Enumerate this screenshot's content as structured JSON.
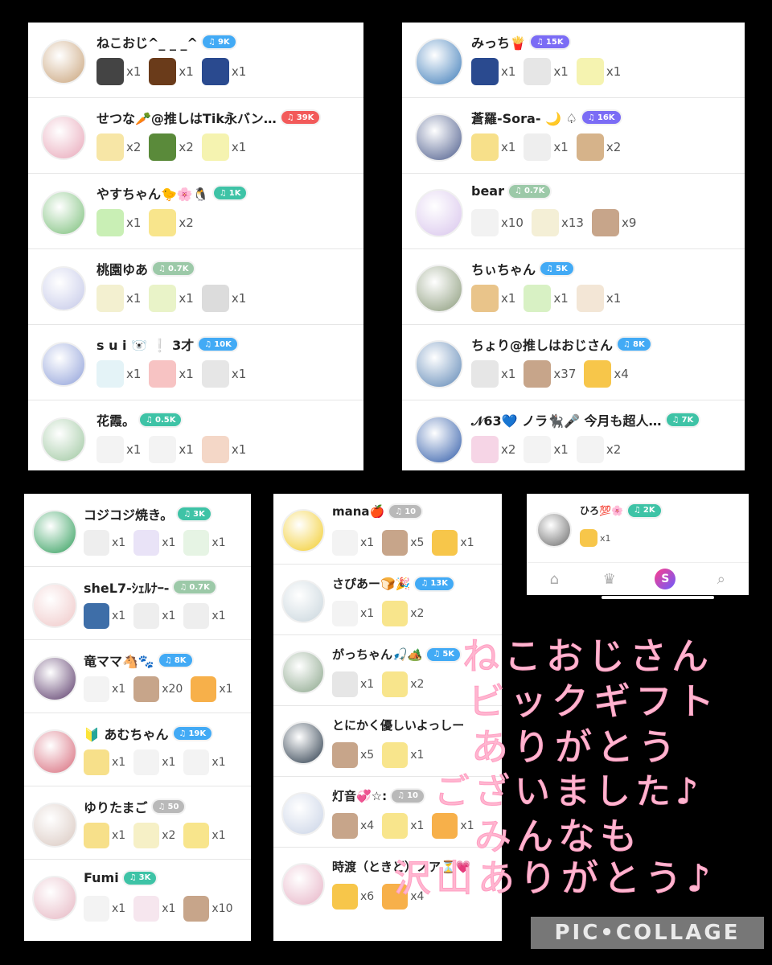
{
  "colors": {
    "badge_blue": "#42aaf5",
    "badge_red": "#f25a5a",
    "badge_green": "#3ec3a6",
    "badge_gray": "#b9b9b9",
    "badge_purple": "#7b6cf5",
    "badge_olive": "#9cc9a8",
    "badge_darkblue": "#5a8ff0"
  },
  "panels": [
    {
      "rows": [
        {
          "name": "ねこおじ^_ _ _^",
          "badge": "9K",
          "badge_color": "#42aaf5",
          "avatar_color": "#c9a37a",
          "gifts": [
            {
              "icon": "night-gift-icon",
              "color": "#444",
              "count": "x1"
            },
            {
              "icon": "fireworks-gift-icon",
              "color": "#6a3b1a",
              "count": "x1"
            },
            {
              "icon": "fever-penguin-gift-icon",
              "color": "#2a4a8f",
              "count": "x1"
            }
          ]
        },
        {
          "name": "せつな🥕@推しはTik永バン…",
          "badge": "39K",
          "badge_color": "#f25a5a",
          "avatar_color": "#e8a6b8",
          "gifts": [
            {
              "icon": "confetti-gift-icon",
              "color": "#f7e6a6",
              "count": "x2"
            },
            {
              "icon": "ghost-gift-icon",
              "color": "#5a8a3a",
              "count": "x2"
            },
            {
              "icon": "rap-gift-icon",
              "color": "#f5f3b0",
              "count": "x1"
            }
          ]
        },
        {
          "name": "やすちゃん🐤🌸🐧",
          "badge": "1K",
          "badge_color": "#3ec3a6",
          "avatar_color": "#7bbf7a",
          "gifts": [
            {
              "icon": "clover-gift-icon",
              "color": "#c9efb5",
              "count": "x1"
            },
            {
              "icon": "oshi-ari-gift-icon",
              "color": "#f8e58c",
              "count": "x2"
            }
          ]
        },
        {
          "name": "桃園ゆあ",
          "badge": "0.7K",
          "badge_color": "#9cc9a8",
          "avatar_color": "#c4c8e8",
          "gifts": [
            {
              "icon": "bouquet-gift-icon",
              "color": "#f3f0d0",
              "count": "x1"
            },
            {
              "icon": "hands-gift-icon",
              "color": "#e9f3c8",
              "count": "x1"
            },
            {
              "icon": "panda-text-gift-icon",
              "color": "#dcdcdc",
              "count": "x1"
            }
          ]
        },
        {
          "name": "s u i 🐻‍❄️ ❕ 3才",
          "badge": "10K",
          "badge_color": "#42aaf5",
          "avatar_color": "#8fa0d9",
          "gifts": [
            {
              "icon": "sparkle-gift-icon",
              "color": "#e4f3f7",
              "count": "x1"
            },
            {
              "icon": "kyaa-gift-icon",
              "color": "#f7c3c3",
              "count": "x1"
            },
            {
              "icon": "panda-cry-gift-icon",
              "color": "#e6e6e6",
              "count": "x1"
            }
          ]
        },
        {
          "name": "花霞。",
          "badge": "0.5K",
          "badge_color": "#3ec3a6",
          "avatar_color": "#9ec7a0",
          "gifts": [
            {
              "icon": "rabbit-gift-icon",
              "color": "#f3f3f3",
              "count": "x1"
            },
            {
              "icon": "cat-gift-icon",
              "color": "#f3f3f3",
              "count": "x1"
            },
            {
              "icon": "sign-gift-icon",
              "color": "#f4d7c7",
              "count": "x1"
            }
          ]
        }
      ]
    },
    {
      "rows": [
        {
          "name": "みっち🍟",
          "badge": "15K",
          "badge_color": "#7b6cf5",
          "avatar_color": "#3b7ab8",
          "gifts": [
            {
              "icon": "fever-penguin-gift-icon",
              "color": "#2a4a8f",
              "count": "x1"
            },
            {
              "icon": "koala-gift-icon",
              "color": "#e6e6e6",
              "count": "x1"
            },
            {
              "icon": "rap-gift-icon",
              "color": "#f5f3b0",
              "count": "x1"
            }
          ]
        },
        {
          "name": "蒼羅-Sora- 🌙 ♤",
          "badge": "16K",
          "badge_color": "#7b6cf5",
          "avatar_color": "#4a5a8a",
          "gifts": [
            {
              "icon": "sushi-gift-icon",
              "color": "#f7e08a",
              "count": "x1"
            },
            {
              "icon": "penguin-gift-icon",
              "color": "#eeeeee",
              "count": "x1"
            },
            {
              "icon": "potato-gift-icon",
              "color": "#d6b38a",
              "count": "x2"
            }
          ]
        },
        {
          "name": "bear",
          "badge": "0.7K",
          "badge_color": "#9cc9a8",
          "avatar_color": "#d8c4ec",
          "gifts": [
            {
              "icon": "bear-gift-icon",
              "color": "#f2f2f2",
              "count": "x10"
            },
            {
              "icon": "music-note-gift-icon",
              "color": "#f4efd6",
              "count": "x13"
            },
            {
              "icon": "hearts-gift-icon",
              "color": "#c7a58a",
              "count": "x9"
            }
          ]
        },
        {
          "name": "ちぃちゃん",
          "badge": "5K",
          "badge_color": "#42aaf5",
          "avatar_color": "#8a9a7a",
          "gifts": [
            {
              "icon": "bear-face-gift-icon",
              "color": "#e9c48a",
              "count": "x1"
            },
            {
              "icon": "sugoi-gift-icon",
              "color": "#d8f1c4",
              "count": "x1"
            },
            {
              "icon": "cat-food-gift-icon",
              "color": "#f3e6d6",
              "count": "x1"
            }
          ]
        },
        {
          "name": "ちょり@推しはおじさん",
          "badge": "8K",
          "badge_color": "#42aaf5",
          "avatar_color": "#5d86b5",
          "gifts": [
            {
              "icon": "koala-gift-icon",
              "color": "#e6e6e6",
              "count": "x1"
            },
            {
              "icon": "hearts-gift-icon",
              "color": "#c7a58a",
              "count": "x37"
            },
            {
              "icon": "clap-gift-icon",
              "color": "#f7c64a",
              "count": "x4"
            }
          ]
        },
        {
          "name": "𝒩63💙 ノラ🐈‍⬛🎤 今月も超人…",
          "badge": "7K",
          "badge_color": "#3ec3a6",
          "avatar_color": "#2e5aa8",
          "gifts": [
            {
              "icon": "thanks-gift-icon",
              "color": "#f6d5e6",
              "count": "x2"
            },
            {
              "icon": "tamarine-gift-icon",
              "color": "#f3f3f3",
              "count": "x1"
            },
            {
              "icon": "black-cat-gift-icon",
              "color": "#f3f3f3",
              "count": "x2"
            }
          ]
        }
      ]
    },
    {
      "rows": [
        {
          "name": "コジコジ焼き。",
          "badge": "3K",
          "badge_color": "#3ec3a6",
          "avatar_color": "#2f9d5a",
          "gifts": [
            {
              "icon": "penguin-gift-icon",
              "color": "#eeeeee",
              "count": "x1"
            },
            {
              "icon": "bed-gift-icon",
              "color": "#e9e3f7",
              "count": "x1"
            },
            {
              "icon": "morning-gift-icon",
              "color": "#e6f4e4",
              "count": "x1"
            }
          ]
        },
        {
          "name": "sheL7-ｼｪﾙﾅｰ-",
          "badge": "0.7K",
          "badge_color": "#9cc9a8",
          "avatar_color": "#efc7c7",
          "gifts": [
            {
              "icon": "polar-bear-gift-icon",
              "color": "#3e6ea8",
              "count": "x1"
            },
            {
              "icon": "onigiri-gift-icon",
              "color": "#eeeeee",
              "count": "x1"
            },
            {
              "icon": "hello-penguin-gift-icon",
              "color": "#eeeeee",
              "count": "x1"
            }
          ]
        },
        {
          "name": "竜ママ🐴🐾",
          "badge": "8K",
          "badge_color": "#42aaf5",
          "avatar_color": "#5a3a6a",
          "gifts": [
            {
              "icon": "tamarine-gift-icon",
              "color": "#f3f3f3",
              "count": "x1"
            },
            {
              "icon": "hearts-gift-icon",
              "color": "#c7a58a",
              "count": "x20"
            },
            {
              "icon": "smile-gift-icon",
              "color": "#f7b04a",
              "count": "x1"
            }
          ]
        },
        {
          "name": "🔰 あむちゃん",
          "badge": "19K",
          "badge_color": "#42aaf5",
          "avatar_color": "#d76a7a",
          "gifts": [
            {
              "icon": "sushi-gift-icon",
              "color": "#f7e08a",
              "count": "x1"
            },
            {
              "icon": "panda-love-gift-icon",
              "color": "#f3f3f3",
              "count": "x1"
            },
            {
              "icon": "rabbit-thanks-gift-icon",
              "color": "#f3f3f3",
              "count": "x1"
            }
          ]
        },
        {
          "name": "ゆりたまご",
          "badge": "50",
          "badge_color": "#b9b9b9",
          "avatar_color": "#d9c8c0",
          "gifts": [
            {
              "icon": "sushi-gift-icon",
              "color": "#f7e08a",
              "count": "x1"
            },
            {
              "icon": "yay-gift-icon",
              "color": "#f6f0c6",
              "count": "x2"
            },
            {
              "icon": "oshi-ari-gift-icon",
              "color": "#f8e58c",
              "count": "x1"
            }
          ]
        },
        {
          "name": "Fumi",
          "badge": "3K",
          "badge_color": "#3ec3a6",
          "avatar_color": "#e6b6c2",
          "gifts": [
            {
              "icon": "seal-gift-icon",
              "color": "#f3f3f3",
              "count": "x1"
            },
            {
              "icon": "penguin-pink-gift-icon",
              "color": "#f6e6ee",
              "count": "x1"
            },
            {
              "icon": "hearts-gift-icon",
              "color": "#c7a58a",
              "count": "x10"
            }
          ]
        }
      ]
    },
    {
      "rows": [
        {
          "name": "mana🍎",
          "badge": "10",
          "badge_color": "#b9b9b9",
          "avatar_color": "#f2cc2a",
          "gifts": [
            {
              "icon": "mochi-gift-icon",
              "color": "#f3f3f3",
              "count": "x1"
            },
            {
              "icon": "hearts-gift-icon",
              "color": "#c7a58a",
              "count": "x5"
            },
            {
              "icon": "clap-gift-icon",
              "color": "#f7c64a",
              "count": "x1"
            }
          ]
        },
        {
          "name": "さぴあー🍞🎉",
          "badge": "13K",
          "badge_color": "#42aaf5",
          "avatar_color": "#c8d5dc",
          "gifts": [
            {
              "icon": "tamarine-gift-icon",
              "color": "#f3f3f3",
              "count": "x1"
            },
            {
              "icon": "oshi-ari-gift-icon",
              "color": "#f8e58c",
              "count": "x2"
            }
          ]
        },
        {
          "name": "がっちゃん🎣🏕️",
          "badge": "5K",
          "badge_color": "#42aaf5",
          "avatar_color": "#8aa58a",
          "gifts": [
            {
              "icon": "koala-gift-icon",
              "color": "#e6e6e6",
              "count": "x1"
            },
            {
              "icon": "oshi-ari-gift-icon",
              "color": "#f8e58c",
              "count": "x2"
            }
          ]
        },
        {
          "name": "とにかく優しいよっしー",
          "badge": "",
          "badge_color": "#42aaf5",
          "avatar_color": "#2a3a4a",
          "gifts": [
            {
              "icon": "hearts-gift-icon",
              "color": "#c7a58a",
              "count": "x5"
            },
            {
              "icon": "oshi-ari-gift-icon",
              "color": "#f8e58c",
              "count": "x1"
            }
          ]
        },
        {
          "name": "灯音💞☆:",
          "badge": "10",
          "badge_color": "#b9b9b9",
          "avatar_color": "#c9d3e6",
          "gifts": [
            {
              "icon": "hearts-gift-icon",
              "color": "#c7a58a",
              "count": "x4"
            },
            {
              "icon": "oshi-ari-gift-icon",
              "color": "#f8e58c",
              "count": "x1"
            },
            {
              "icon": "smile-gift-icon",
              "color": "#f7b04a",
              "count": "x1"
            }
          ]
        },
        {
          "name": "時渡（ときど）ノア⏳💗",
          "badge": "",
          "badge_color": "#42aaf5",
          "avatar_color": "#e7b3c6",
          "gifts": [
            {
              "icon": "clap-gift-icon",
              "color": "#f7c64a",
              "count": "x6"
            },
            {
              "icon": "smile-gift-icon",
              "color": "#f7b04a",
              "count": "x4"
            }
          ]
        }
      ]
    },
    {
      "rows": [
        {
          "name": "ひろ💯🌸",
          "badge": "2K",
          "badge_color": "#3ec3a6",
          "avatar_color": "#6a6a6a",
          "gifts": [
            {
              "icon": "clap-gift-icon",
              "color": "#f7c64a",
              "count": "x1"
            }
          ]
        }
      ]
    }
  ],
  "nav": {
    "home_icon": "⌂",
    "crown_icon": "♛",
    "center_icon": "S",
    "search_icon": "⌕"
  },
  "message": [
    "ねこおじさん",
    "ビックギフト",
    "ありがとう",
    "ございました♪",
    "みんなも",
    "沢山ありがとう♪"
  ],
  "watermark": "PIC•COLLAGE"
}
